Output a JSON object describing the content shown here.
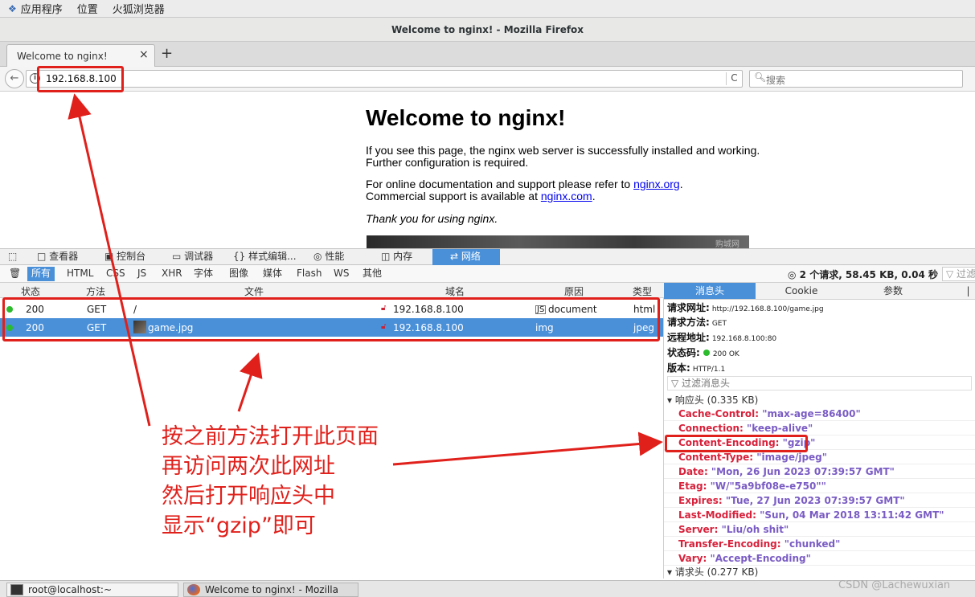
{
  "top_bar": {
    "apps": "应用程序",
    "places": "位置",
    "firefox": "火狐浏览器"
  },
  "window_title": "Welcome to nginx! - Mozilla Firefox",
  "tab": {
    "title": "Welcome to nginx!",
    "close": "×",
    "new_tab": "+"
  },
  "nav": {
    "back": "←",
    "info": "i",
    "url": "192.168.8.100",
    "reload": "C",
    "search_placeholder": "搜索"
  },
  "page": {
    "heading": "Welcome to nginx!",
    "p1_line1": "If you see this page, the nginx web server is successfully installed and working.",
    "p1_line2": "Further configuration is required.",
    "p2_line1_pre": "For online documentation and support please refer to ",
    "p2_link1": "nginx.org",
    "p2_line1_post": ".",
    "p2_line2_pre": "Commercial support is available at ",
    "p2_link2": "nginx.com",
    "p2_line2_post": ".",
    "thanks": "Thank you for using nginx.",
    "image_watermark": "购城网"
  },
  "devtools": {
    "tabs": [
      "查看器",
      "控制台",
      "调试器",
      "样式编辑...",
      "性能",
      "内存",
      "网络"
    ],
    "tab_icons": [
      "□",
      "▣",
      "▭",
      "{}",
      "◎",
      "◫",
      "⇄"
    ],
    "active_tab": "网络",
    "filters": [
      "所有",
      "HTML",
      "CSS",
      "JS",
      "XHR",
      "字体",
      "图像",
      "媒体",
      "Flash",
      "WS",
      "其他"
    ],
    "trash_icon": "🗑",
    "summary": "2 个请求, 58.45 KB, 0.04 秒",
    "summary_icon": "◎",
    "filter_url": "▽ 过滤",
    "columns": [
      "状态",
      "方法",
      "文件",
      "域名",
      "原因",
      "类型"
    ],
    "requests": [
      {
        "status": "200",
        "method": "GET",
        "file": "/",
        "domain": "192.168.8.100",
        "cause": "document",
        "type": "html"
      },
      {
        "status": "200",
        "method": "GET",
        "file": "game.jpg",
        "domain": "192.168.8.100",
        "cause": "img",
        "type": "jpeg"
      }
    ],
    "detail_tabs": [
      "消息头",
      "Cookie",
      "参数",
      "|"
    ],
    "detail": {
      "request_url_label": "请求网址:",
      "request_url": "http://192.168.8.100/game.jpg",
      "method_label": "请求方法:",
      "method": "GET",
      "remote_label": "远程地址:",
      "remote": "192.168.8.100:80",
      "status_label": "状态码:",
      "status": "200 OK",
      "version_label": "版本:",
      "version": "HTTP/1.1",
      "filter_headers": "▽ 过滤消息头",
      "response_section": "▾ 响应头 (0.335 KB)",
      "request_section": "▾ 请求头 (0.277 KB)",
      "response_headers": [
        {
          "k": "Cache-Control",
          "v": "\"max-age=86400\""
        },
        {
          "k": "Connection",
          "v": "\"keep-alive\""
        },
        {
          "k": "Content-Encoding",
          "v": "\"gzip\""
        },
        {
          "k": "Content-Type",
          "v": "\"image/jpeg\""
        },
        {
          "k": "Date",
          "v": "\"Mon, 26 Jun 2023 07:39:57 GMT\""
        },
        {
          "k": "Etag",
          "v": "\"W/\"5a9bf08e-e750\"\""
        },
        {
          "k": "Expires",
          "v": "\"Tue, 27 Jun 2023 07:39:57 GMT\""
        },
        {
          "k": "Last-Modified",
          "v": "\"Sun, 04 Mar 2018 13:11:42 GMT\""
        },
        {
          "k": "Server",
          "v": "\"Liu/oh shit\""
        },
        {
          "k": "Transfer-Encoding",
          "v": "\"chunked\""
        },
        {
          "k": "Vary",
          "v": "\"Accept-Encoding\""
        }
      ]
    }
  },
  "taskbar": {
    "terminal": "root@localhost:~",
    "firefox": "Welcome to nginx! - Mozilla Firefox"
  },
  "annotation": {
    "line1": "按之前方法打开此页面",
    "line2": "再访问两次此网址",
    "line3": "然后打开响应头中",
    "line4": "显示“gzip”即可"
  },
  "watermark": "CSDN @Lachewuxian",
  "colors": {
    "accent": "#4a90d9",
    "annotation_red": "#e0201b",
    "status_ok": "#2cbb2c",
    "header_key": "#d8213b",
    "header_value": "#7a5cc4",
    "link": "#0000ee"
  }
}
